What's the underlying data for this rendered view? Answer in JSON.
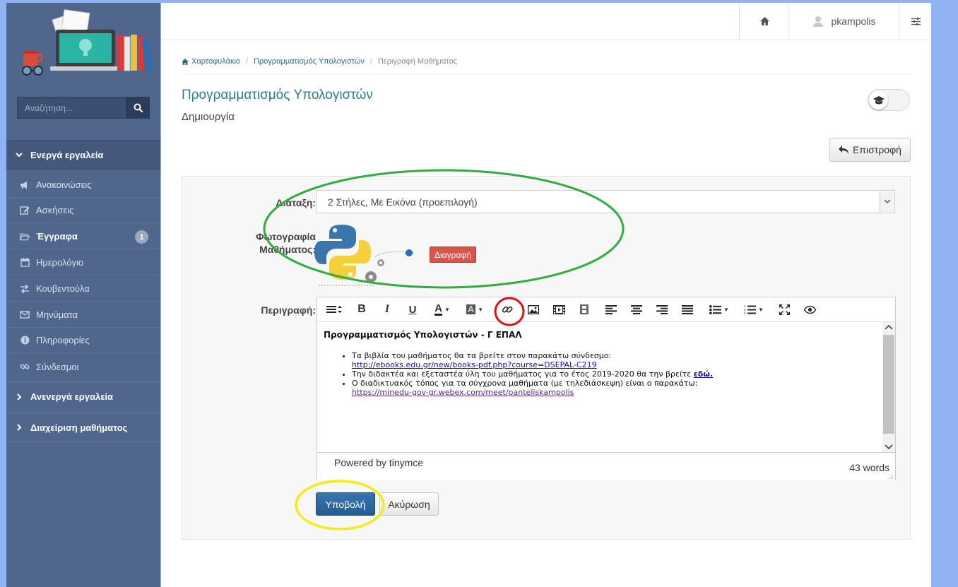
{
  "sidebar": {
    "search_placeholder": "Αναζήτηση...",
    "sections": {
      "active": "Ενεργά εργαλεία",
      "inactive": "Ανενεργά εργαλεία",
      "manage": "Διαχείριση μαθήματος"
    },
    "items": [
      {
        "label": "Ανακοινώσεις",
        "icon": "bullhorn-icon"
      },
      {
        "label": "Ασκήσεις",
        "icon": "edit-icon"
      },
      {
        "label": "Έγγραφα",
        "icon": "folder-open-icon",
        "badge": "1"
      },
      {
        "label": "Ημερολόγιο",
        "icon": "calendar-icon"
      },
      {
        "label": "Κουβεντούλα",
        "icon": "exchange-arrows-icon"
      },
      {
        "label": "Μηνύματα",
        "icon": "envelope-icon"
      },
      {
        "label": "Πληροφορίες",
        "icon": "info-circle-icon"
      },
      {
        "label": "Σύνδεσμοι",
        "icon": "link-icon"
      }
    ]
  },
  "topbar": {
    "username": "pkampolis"
  },
  "breadcrumb": {
    "items": [
      "Χαρτοφυλάκιο",
      "Προγραμματισμός Υπολογιστών",
      "Περιγραφή Μαθήματος"
    ]
  },
  "page": {
    "title": "Προγραμματισμός Υπολογιστών",
    "subtitle": "Δημιουργία",
    "back_label": "Επιστροφή"
  },
  "form": {
    "layout_label": "Διάταξη:",
    "layout_value": "2 Στήλες, Με Εικόνα (προεπιλογή)",
    "photo_label_line1": "Φωτογραφία",
    "photo_label_line2": "Μαθήματος:",
    "delete_label": "Διαγραφή",
    "description_label": "Περιγραφή:",
    "submit_label": "Υποβολή",
    "cancel_label": "Ακύρωση"
  },
  "editor": {
    "heading": "Προγραμματισμός Υπολογιστών - Γ ΕΠΑΛ",
    "bullets": [
      {
        "text": "Τα βιβλία του μαθήματος θα τα βρείτε στον παρακάτω σύνδεσμο:",
        "link": "http://ebooks.edu.gr/new/books-pdf.php?course=DSEPAL-C219"
      },
      {
        "text": "Την διδακτέα και εξεταστέα ύλη του μαθήματος για το έτος 2019-2020 θα την βρείτε ",
        "link": "εδώ."
      },
      {
        "text": "Ο διαδικτυακός τόπος για τα σύγχρονα μαθήματα (με τηλεδιάσκεψη) είναι ο παρακάτω:",
        "link": "https://minedu-gov-gr.webex.com/meet/panteliskampolis"
      }
    ],
    "powered_by": "Powered by tinymce",
    "word_count": "43 words"
  },
  "colors": {
    "sidebar_bg": "#50668c",
    "accent_title": "#2a7f8a",
    "submit_blue": "#2a6aa6",
    "delete_red": "#d9534f",
    "annotation_green": "#2fae3e",
    "annotation_red": "#e01010",
    "annotation_yellow": "#f2ec1a"
  }
}
